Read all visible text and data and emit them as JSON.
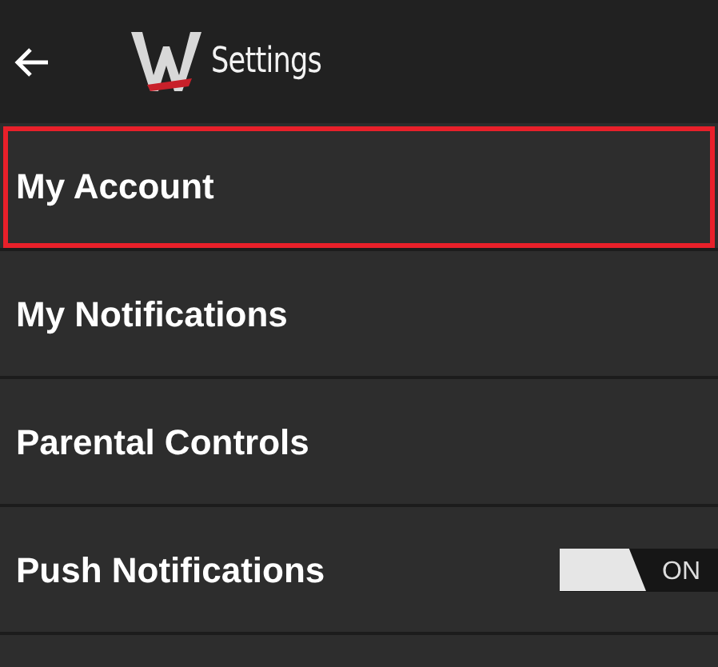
{
  "header": {
    "title": "Settings"
  },
  "items": [
    {
      "kind": "link",
      "label": "My Account",
      "selected": true
    },
    {
      "kind": "link",
      "label": "My Notifications",
      "selected": false
    },
    {
      "kind": "link",
      "label": "Parental Controls",
      "selected": false
    },
    {
      "kind": "toggle",
      "label": "Push Notifications",
      "selected": false,
      "on": true,
      "state_text": "ON"
    }
  ]
}
